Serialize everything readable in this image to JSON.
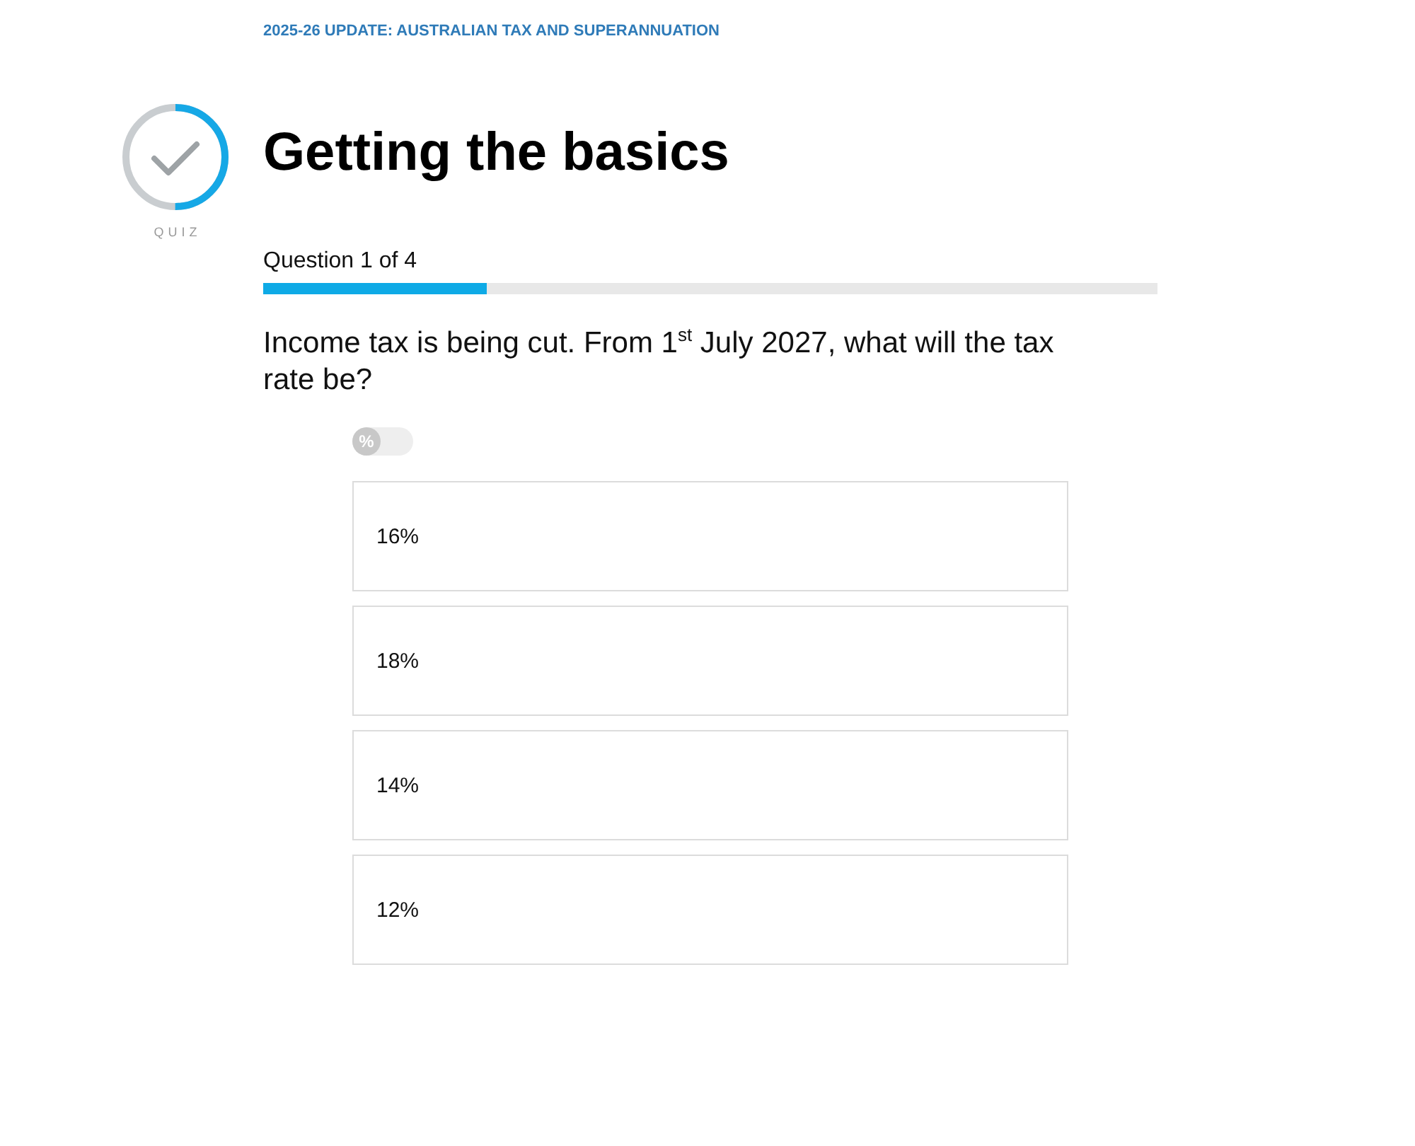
{
  "course": {
    "title": "2025-26 UPDATE: AUSTRALIAN TAX AND SUPERANNUATION"
  },
  "quiz": {
    "label": "QUIZ",
    "title": "Getting the basics"
  },
  "progress": {
    "label": "Question 1 of 4",
    "level": 0.25
  },
  "question": {
    "text": "Income tax is being cut. From 1$^{st}$ July 2027, what will the tax rate be?"
  },
  "toggle": {
    "label": "%",
    "on": false
  },
  "options": [
    {
      "label": "16%",
      "selected": false
    },
    {
      "label": "18%",
      "selected": false
    },
    {
      "label": "14%",
      "selected": false
    },
    {
      "label": "12%",
      "selected": false
    }
  ]
}
